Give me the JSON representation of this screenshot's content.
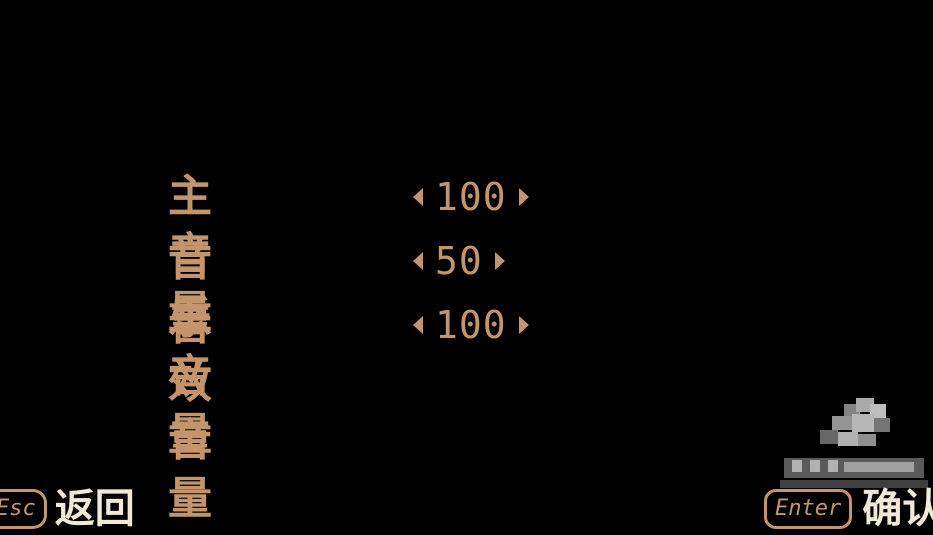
{
  "colors": {
    "background": "#000000",
    "text": "#c4946a",
    "hint_text": "#f2e8d8"
  },
  "settings": [
    {
      "label": "主音量",
      "value": "100"
    },
    {
      "label": "音乐音量",
      "value": "50"
    },
    {
      "label": "音效音量",
      "value": "100"
    }
  ],
  "hints": {
    "back_key": "Esc",
    "back_label": "返回",
    "confirm_key": "Enter",
    "confirm_label": "确认"
  },
  "icons": {
    "decrease": "arrow-left-icon",
    "increase": "arrow-right-icon",
    "watermark": "pixelated-watermark"
  }
}
